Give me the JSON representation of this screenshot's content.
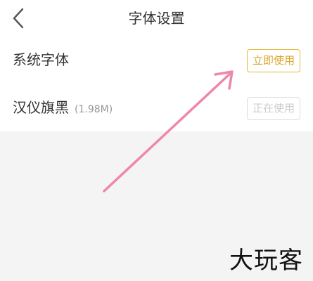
{
  "header": {
    "back_icon": "chevron-left-icon",
    "title": "字体设置"
  },
  "fonts": [
    {
      "name": "系统字体",
      "size": "",
      "button": "立即使用",
      "button_state": "available"
    },
    {
      "name": "汉仪旗黑",
      "size": "(1.98M)",
      "button": "正在使用",
      "button_state": "in-use"
    }
  ],
  "colors": {
    "accent": "#e6bb3a",
    "arrow": "#ee88a8"
  },
  "watermark": "大玩客"
}
